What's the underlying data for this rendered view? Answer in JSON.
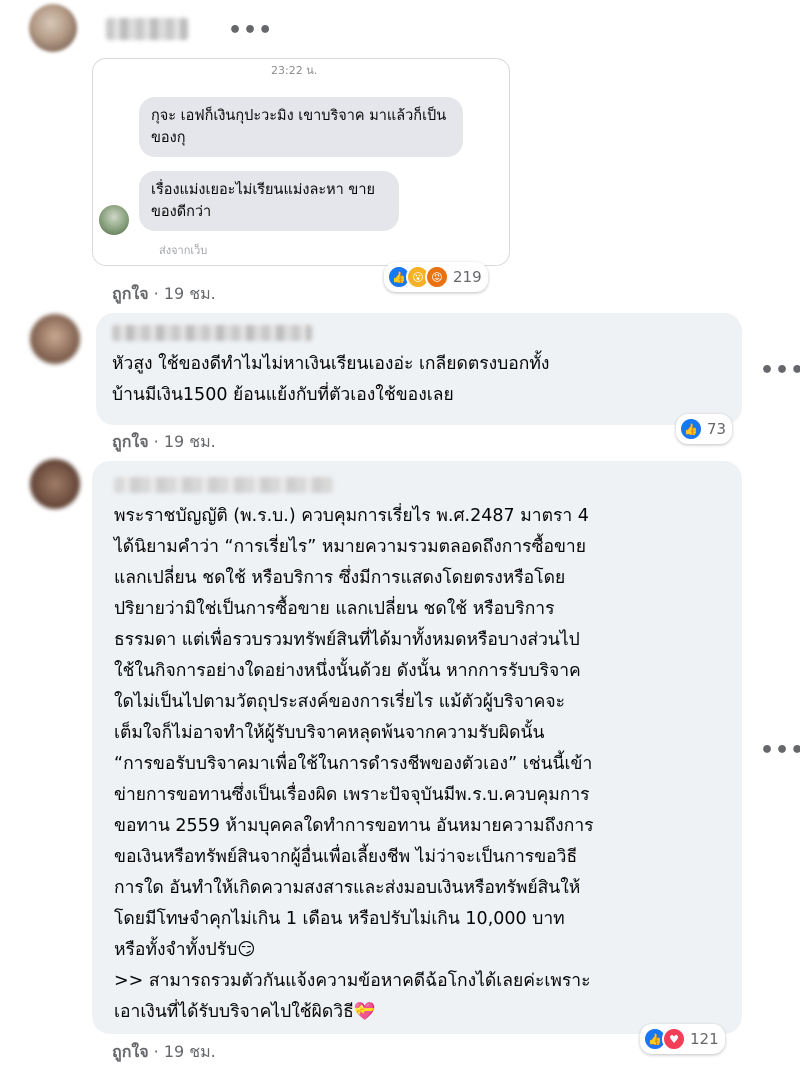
{
  "comment1": {
    "screenshot": {
      "time": "23:22 น.",
      "messages": [
        "กุจะ เอฟก็เงินกุปะวะมิง เขาบริจาค มาแล้วก็เป็นของกุ",
        "เรื่องแม่งเยอะไม่เรียนแม่งละหา ขายของดีกว่า"
      ],
      "sent_from": "ส่งจากเว็บ"
    },
    "reactions": {
      "icons": [
        "like-icon",
        "wow-icon",
        "angry-icon"
      ],
      "count": "219"
    },
    "actions": {
      "like": "ถูกใจ",
      "time": "19 ชม."
    }
  },
  "comment2": {
    "text_lines": [
      "หัวสูง ใช้ของดีทำไมไม่หาเงินเรียนเองอ่ะ เกลียดตรงบอกทั้ง",
      "บ้านมีเงิน1500 ย้อนแย้งกับที่ตัวเองใช้ของเลย"
    ],
    "reactions": {
      "icons": [
        "like-icon"
      ],
      "count": "73"
    },
    "actions": {
      "like": "ถูกใจ",
      "time": "19 ชม."
    }
  },
  "comment3": {
    "text_lines": [
      "พระราชบัญญัติ (พ.ร.บ.) ควบคุมการเรี่ยไร พ.ศ.2487 มาตรา 4",
      "ได้นิยามคำว่า “การเรี่ยไร” หมายความรวมตลอดถึงการซื้อขาย",
      "แลกเปลี่ยน ชดใช้ หรือบริการ ซึ่งมีการแสดงโดยตรงหรือโดย",
      "ปริยายว่ามิใช่เป็นการซื้อขาย แลกเปลี่ยน ชดใช้ หรือบริการ",
      "ธรรมดา แต่เพื่อรวบรวมทรัพย์สินที่ได้มาทั้งหมดหรือบางส่วนไป",
      "ใช้ในกิจการอย่างใดอย่างหนึ่งนั้นด้วย ดังนั้น หากการรับบริจาค",
      "ใดไม่เป็นไปตามวัตถุประสงค์ของการเรี่ยไร แม้ตัวผู้บริจาคจะ",
      "เต็มใจก็ไม่อาจทำให้ผู้รับบริจาคหลุดพ้นจากความรับผิดนั้น",
      "“การขอรับบริจาคมาเพื่อใช้ในการดำรงชีพของตัวเอง” เช่นนี้เข้า",
      "ข่ายการขอทานซึ่งเป็นเรื่องผิด เพราะปัจจุบันมีพ.ร.บ.ควบคุมการ",
      "ขอทาน 2559 ห้ามบุคคลใดทำการขอทาน อันหมายความถึงการ",
      "ขอเงินหรือทรัพย์สินจากผู้อื่นเพื่อเลี้ยงชีพ ไม่ว่าจะเป็นการขอวิธี",
      "การใด อันทำให้เกิดความสงสารและส่งมอบเงินหรือทรัพย์สินให้",
      "โดยมีโทษจำคุกไม่เกิน 1 เดือน หรือปรับไม่เกิน 10,000 บาท",
      "หรือทั้งจำทั้งปรับ😏",
      ">> สามารถรวมตัวกันแจ้งความข้อหาคดีฉ้อโกงได้เลยค่ะเพราะ",
      "เอาเงินที่ได้รับบริจาคไปใช้ผิดวิธี💝"
    ],
    "reactions": {
      "icons": [
        "like-icon",
        "care-icon"
      ],
      "count": "121"
    },
    "actions": {
      "like": "ถูกใจ",
      "time": "19 ชม."
    }
  },
  "more_glyph": "•••",
  "colors": {
    "like": "#1877f2",
    "bubble": "#eff2f5",
    "meta": "#65676b"
  }
}
